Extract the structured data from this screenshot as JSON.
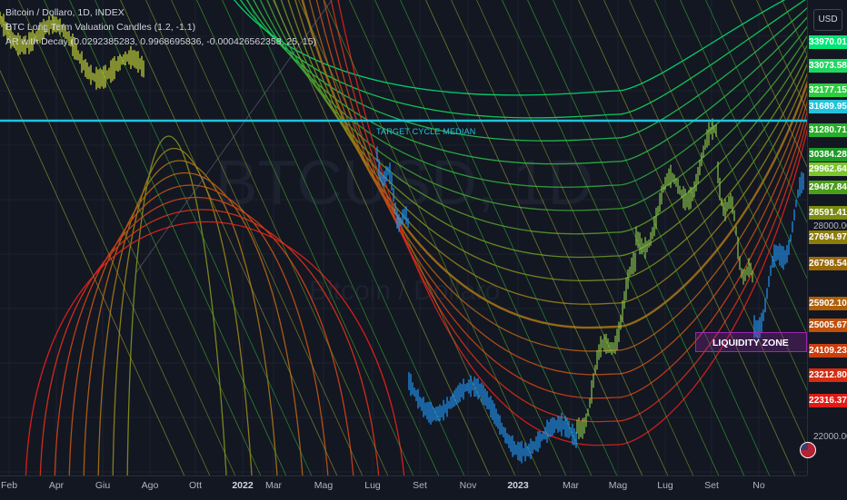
{
  "legend": {
    "line1": "Bitcoin / Dollaro, 1D, INDEX",
    "line2": "BTC Long Term Valuation Candles (1.2, -1.1)",
    "line3": "AR with Decay (0.0292385283, 0.9968695836, -0.000426562358, 25, 15)"
  },
  "watermark": {
    "symbol": "BTCUSD, 1D",
    "name": "Bitcoin / Dollaro"
  },
  "currency": "USD",
  "median_label": "TARGET CYCLE MEDIAN",
  "liquidity_zone": {
    "label": "LIQUIDITY ZONE",
    "color": "#9c27b0"
  },
  "colors": {
    "background": "#131722",
    "median_line": "#22c3dc",
    "up_candle": "#8bc34a",
    "down_candle": "#2196f3"
  },
  "chart_data": {
    "type": "line",
    "title": "",
    "x_ticks": [
      {
        "label": "Feb",
        "bold": false
      },
      {
        "label": "Apr",
        "bold": false
      },
      {
        "label": "Giu",
        "bold": false
      },
      {
        "label": "Ago",
        "bold": false
      },
      {
        "label": "Ott",
        "bold": false
      },
      {
        "label": "2022",
        "bold": true
      },
      {
        "label": "Mar",
        "bold": false
      },
      {
        "label": "Mag",
        "bold": false
      },
      {
        "label": "Lug",
        "bold": false
      },
      {
        "label": "Set",
        "bold": false
      },
      {
        "label": "Nov",
        "bold": false
      },
      {
        "label": "2023",
        "bold": true
      },
      {
        "label": "Mar",
        "bold": false
      },
      {
        "label": "Mag",
        "bold": false
      },
      {
        "label": "Lug",
        "bold": false
      },
      {
        "label": "Set",
        "bold": false
      },
      {
        "label": "No",
        "bold": false
      }
    ],
    "y_axis_labels": [
      "28000.00",
      "22000.00"
    ],
    "price_tags": [
      {
        "value": "33970.01",
        "color": "#00e676"
      },
      {
        "value": "33073.58",
        "color": "#1ed760"
      },
      {
        "value": "32177.15",
        "color": "#2ecc40"
      },
      {
        "value": "31689.95",
        "color": "#22c3dc"
      },
      {
        "value": "31280.71",
        "color": "#27ae2a"
      },
      {
        "value": "30384.28",
        "color": "#1f9a26"
      },
      {
        "value": "29962.64",
        "color": "#7cc62e"
      },
      {
        "value": "29487.84",
        "color": "#4a9e1a"
      },
      {
        "value": "28591.41",
        "color": "#7a8c12"
      },
      {
        "value": "27694.97",
        "color": "#8c7d0c"
      },
      {
        "value": "26798.54",
        "color": "#9a6a0a"
      },
      {
        "value": "25902.10",
        "color": "#b06008"
      },
      {
        "value": "25005.67",
        "color": "#c24f0a"
      },
      {
        "value": "24109.23",
        "color": "#cc3d0e"
      },
      {
        "value": "23212.80",
        "color": "#d62c12"
      },
      {
        "value": "22316.37",
        "color": "#e01b16"
      }
    ],
    "median_value": 31689.95,
    "liquidity_zone_range": [
      24900,
      25700
    ],
    "series": [
      {
        "shape": "cycle_band",
        "count": 16,
        "colors": [
          "#00e676",
          "#10d85a",
          "#20c84e",
          "#2cb844",
          "#30a83a",
          "#40a032",
          "#569a2a",
          "#6a9422",
          "#7e8c1c",
          "#928018",
          "#a27016",
          "#b06014",
          "#be5014",
          "#ca4016",
          "#d43018",
          "#e0201a"
        ]
      }
    ],
    "ohlc_clusters": [
      {
        "period": "2021 Jan-Jul",
        "color": "#cddc39"
      },
      {
        "period": "2022 May-Dec",
        "color": "#2196f3"
      },
      {
        "period": "2023 Mar-Oct",
        "color": "#8bc34a"
      }
    ]
  }
}
